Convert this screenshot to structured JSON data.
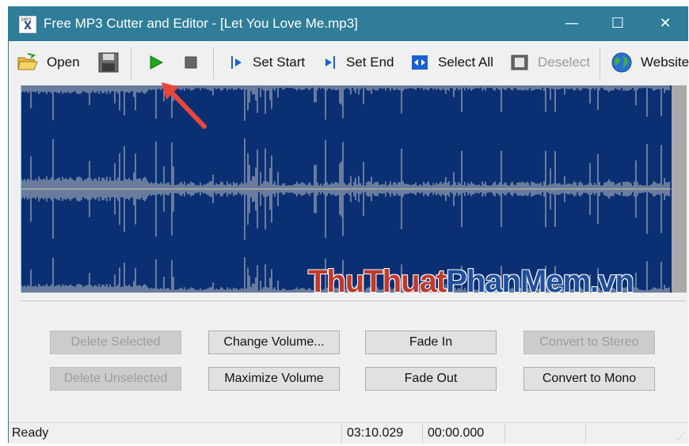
{
  "titlebar": {
    "title": "Free MP3 Cutter and Editor - [Let You Love Me.mp3]",
    "icon_text": "MP3",
    "minimize": "—",
    "maximize": "☐",
    "close": "✕"
  },
  "toolbar": {
    "open_label": "Open",
    "set_start_label": "Set Start",
    "set_end_label": "Set End",
    "select_all_label": "Select All",
    "deselect_label": "Deselect",
    "website_label": "Website"
  },
  "watermark": {
    "part1": "Thu",
    "part2": "Thuat",
    "part3": "PhanMem",
    "part4": ".vn",
    "colors": [
      "#c0392b",
      "#c0392b",
      "#1f4f9a",
      "#1f4f9a"
    ]
  },
  "waveform": {
    "background": "#0a2f73",
    "wave_color": "#c8c8c8",
    "channels": 2
  },
  "buttons": {
    "delete_selected": "Delete Selected",
    "delete_unselected": "Delete Unselected",
    "change_volume": "Change Volume...",
    "maximize_volume": "Maximize Volume",
    "fade_in": "Fade In",
    "fade_out": "Fade Out",
    "convert_to_stereo": "Convert to Stereo",
    "convert_to_mono": "Convert to Mono"
  },
  "status": {
    "state": "Ready",
    "duration": "03:10.029",
    "position": "00:00.000"
  }
}
